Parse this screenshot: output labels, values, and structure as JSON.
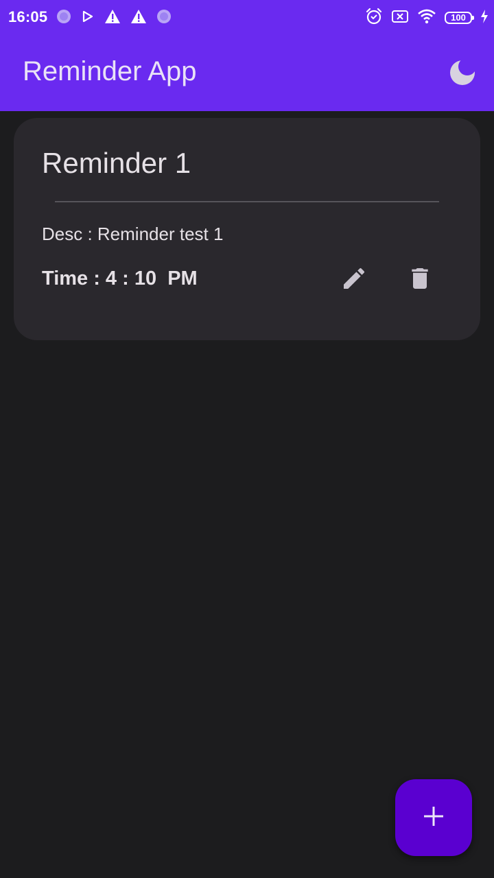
{
  "status_bar": {
    "time": "16:05",
    "battery_level": "100",
    "left_icons": [
      "record-circle-icon",
      "play-store-icon",
      "warning-icon",
      "warning-icon",
      "record-circle-icon"
    ],
    "right_icons": [
      "alarm-icon",
      "sim-off-icon",
      "wifi-icon",
      "battery-icon",
      "charging-bolt-icon"
    ]
  },
  "app_bar": {
    "title": "Reminder App",
    "theme_toggle_icon": "moon-icon"
  },
  "reminders": [
    {
      "title": "Reminder 1",
      "description": "Desc : Reminder test 1",
      "time": "Time : 4 : 10  PM",
      "actions": [
        "edit-icon",
        "delete-icon"
      ]
    }
  ],
  "fab": {
    "icon": "plus-icon"
  },
  "colors": {
    "primary": "#6a2af0",
    "fab": "#5a00d0",
    "background": "#1c1c1e",
    "card": "#2a282d",
    "text": "#e6e1e6",
    "icon": "#c9c4ce"
  }
}
